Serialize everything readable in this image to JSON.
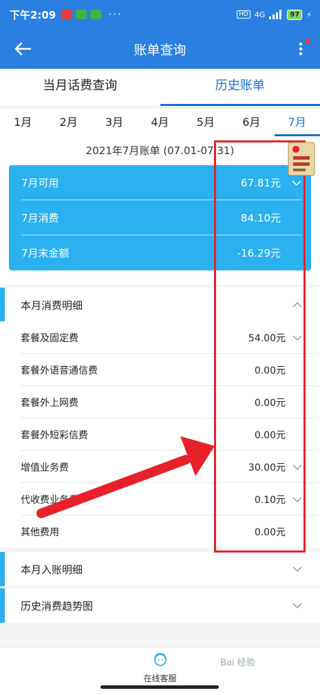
{
  "status": {
    "time": "下午2:09",
    "network": "4G",
    "battery": "97"
  },
  "nav": {
    "title": "账单查询"
  },
  "tabs": [
    "当月话费查询",
    "历史账单"
  ],
  "months": [
    "1月",
    "2月",
    "3月",
    "4月",
    "5月",
    "6月",
    "7月"
  ],
  "bill": {
    "period": "2021年7月账单 (07.01-07.31)",
    "summary": [
      {
        "label": "7月可用",
        "value": "67.81元"
      },
      {
        "label": "7月消费",
        "value": "84.10元"
      },
      {
        "label": "7月末金额",
        "value": "-16.29元"
      }
    ]
  },
  "detail": {
    "title": "本月消费明细",
    "items": [
      {
        "label": "套餐及固定费",
        "value": "54.00元"
      },
      {
        "label": "套餐外语音通信费",
        "value": "0.00元"
      },
      {
        "label": "套餐外上网费",
        "value": "0.00元"
      },
      {
        "label": "套餐外短彩信费",
        "value": "0.00元"
      },
      {
        "label": "增值业务费",
        "value": "30.00元"
      },
      {
        "label": "代收费业务费",
        "value": "0.10元"
      },
      {
        "label": "其他费用",
        "value": "0.00元"
      }
    ]
  },
  "sections": {
    "income": "本月入账明细",
    "trend": "历史消费趋势图"
  },
  "bottom": {
    "service": "在线客服"
  },
  "watermark": "Bai 经验",
  "colors": {
    "primary": "#2b7fe0",
    "card": "#2bb0f0",
    "accent": "#1a6fd6",
    "annotation": "#e8202a"
  }
}
